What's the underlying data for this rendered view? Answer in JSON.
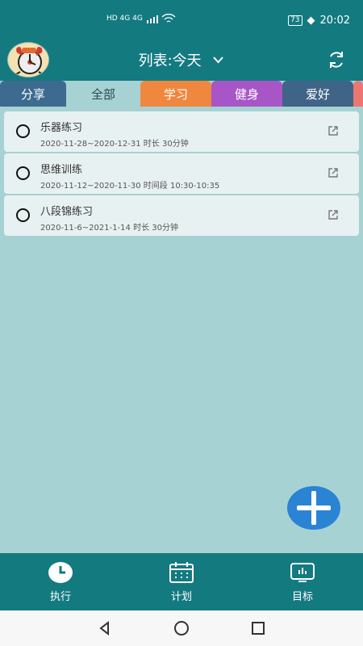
{
  "status": {
    "left_signal": "HD 4G 4G",
    "battery": "73",
    "time": "20:02"
  },
  "header": {
    "title": "列表:今天",
    "chevron_icon": "chevron-down-icon",
    "refresh_icon": "refresh-icon"
  },
  "tabs": [
    {
      "label": "分享",
      "color": "#3c6b8f"
    },
    {
      "label": "全部",
      "color": "#a7d2d3"
    },
    {
      "label": "学习",
      "color": "#f0873e"
    },
    {
      "label": "健身",
      "color": "#a856c7"
    },
    {
      "label": "爱好",
      "color": "#3f6487"
    }
  ],
  "tasks": [
    {
      "title": "乐器练习",
      "detail": "2020-11-28~2020-12-31 时长 30分钟"
    },
    {
      "title": "思维训练",
      "detail": "2020-11-12~2020-11-30 时间段 10:30-10:35"
    },
    {
      "title": "八段锦练习",
      "detail": "2020-11-6~2021-1-14 时长 30分钟"
    }
  ],
  "bottom_nav": [
    {
      "label": "执行",
      "icon": "clock-icon"
    },
    {
      "label": "计划",
      "icon": "calendar-icon"
    },
    {
      "label": "目标",
      "icon": "monitor-icon"
    }
  ],
  "colors": {
    "primary": "#137a80",
    "background": "#a7d2d3",
    "fab": "#2b83d4"
  }
}
